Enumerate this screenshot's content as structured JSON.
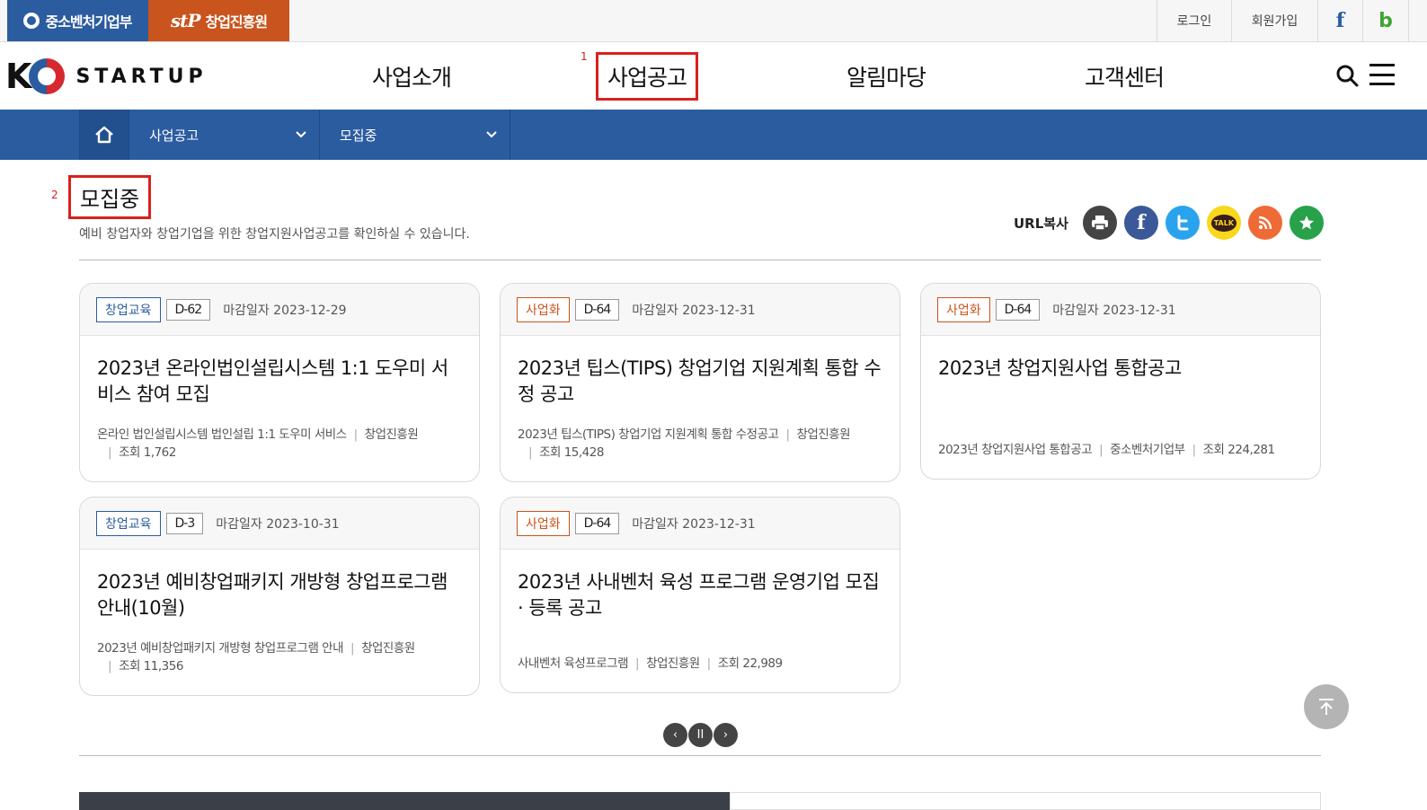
{
  "topbar": {
    "ministry_label": "중소벤처기업부",
    "agency_label": "창업진흥원",
    "agency_logo_text": "stP",
    "login": "로그인",
    "join": "회원가입",
    "facebook_glyph": "f",
    "blog_glyph": "b"
  },
  "header": {
    "brand_k": "K",
    "brand_word": "STARTUP",
    "nav": [
      "사업소개",
      "사업공고",
      "알림마당",
      "고객센터"
    ],
    "marker_1": "1",
    "marker_2": "2"
  },
  "subnav": {
    "menu1": "사업공고",
    "menu2": "모집중"
  },
  "page": {
    "title": "모집중",
    "description": "예비 창업자와 창업기업을 위한 창업지원사업공고를 확인하실 수 있습니다.",
    "url_copy": "URL복사",
    "kakao_label": "TALK"
  },
  "cards": [
    {
      "tag": "창업교육",
      "tag_type": "edu",
      "dday": "D-62",
      "deadline": "마감일자 2023-12-29",
      "title": "2023년 온라인법인설립시스템 1:1 도우미 서비스 참여 모집",
      "summary": "온라인 법인설립시스템 법인설립 1:1 도우미 서비스",
      "org": "창업진흥원",
      "views": "조회 1,762"
    },
    {
      "tag": "사업화",
      "tag_type": "biz",
      "dday": "D-64",
      "deadline": "마감일자 2023-12-31",
      "title": "2023년 팁스(TIPS) 창업기업 지원계획 통합 수정 공고",
      "summary": "2023년 팁스(TIPS) 창업기업 지원계획 통합 수정공고",
      "org": "창업진흥원",
      "views": "조회 15,428"
    },
    {
      "tag": "사업화",
      "tag_type": "biz",
      "dday": "D-64",
      "deadline": "마감일자 2023-12-31",
      "title": "2023년 창업지원사업 통합공고",
      "summary": "2023년 창업지원사업 통합공고",
      "org": "중소벤처기업부",
      "views": "조회 224,281"
    },
    {
      "tag": "창업교육",
      "tag_type": "edu",
      "dday": "D-3",
      "deadline": "마감일자 2023-10-31",
      "title": "2023년 예비창업패키지 개방형 창업프로그램 안내(10월)",
      "summary": "2023년 예비창업패키지 개방형 창업프로그램 안내",
      "org": "창업진흥원",
      "views": "조회 11,356"
    },
    {
      "tag": "사업화",
      "tag_type": "biz",
      "dday": "D-64",
      "deadline": "마감일자 2023-12-31",
      "title": "2023년 사내벤처 육성 프로그램 운영기업 모집 · 등록 공고",
      "summary": "사내벤처 육성프로그램",
      "org": "창업진흥원",
      "views": "조회 22,989"
    }
  ],
  "pager": {
    "prev": "‹",
    "pause": "II",
    "next": "›"
  },
  "colors": {
    "primary": "#2b5ca0",
    "accent": "#c9541d",
    "highlight": "#d9211e"
  }
}
